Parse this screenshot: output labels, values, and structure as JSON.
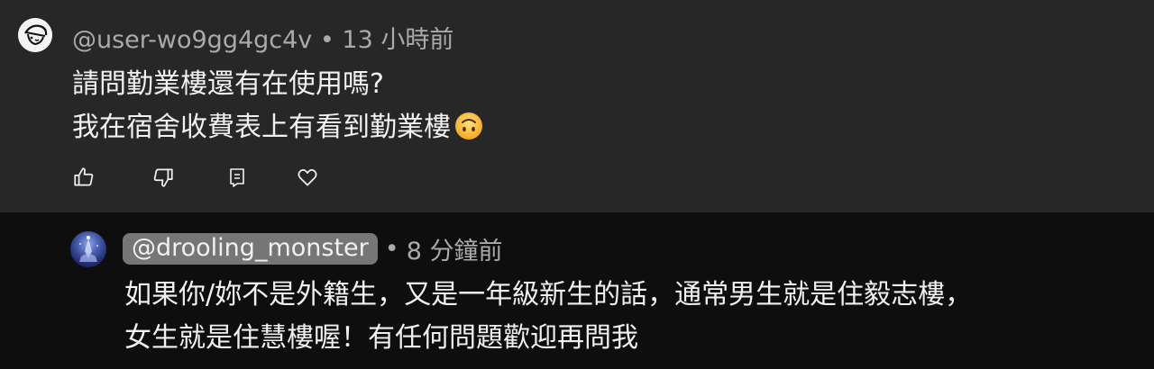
{
  "comment": {
    "username": "@user-wo9gg4gc4v",
    "separator": "•",
    "time": "13 小時前",
    "lines": [
      "請問勤業樓還有在使用嗎?",
      "我在宿舍收費表上有看到勤業樓"
    ],
    "emoji": "upside-down-face",
    "actions": [
      "thumbs-up-icon",
      "thumbs-down-icon",
      "reply-icon",
      "heart-icon"
    ]
  },
  "reply": {
    "username": "@drooling_monster",
    "separator": "•",
    "time": "8 分鐘前",
    "lines": [
      "如果你/妳不是外籍生，又是一年級新生的話，通常男生就是住毅志樓，",
      "女生就是住慧樓喔！有任何問題歡迎再問我"
    ]
  },
  "colors": {
    "comment_bg": "#272727",
    "reply_bg": "#0e0e0e",
    "text": "#f1f1f1",
    "meta": "#aaaaaa",
    "mention_bg": "#767676"
  }
}
